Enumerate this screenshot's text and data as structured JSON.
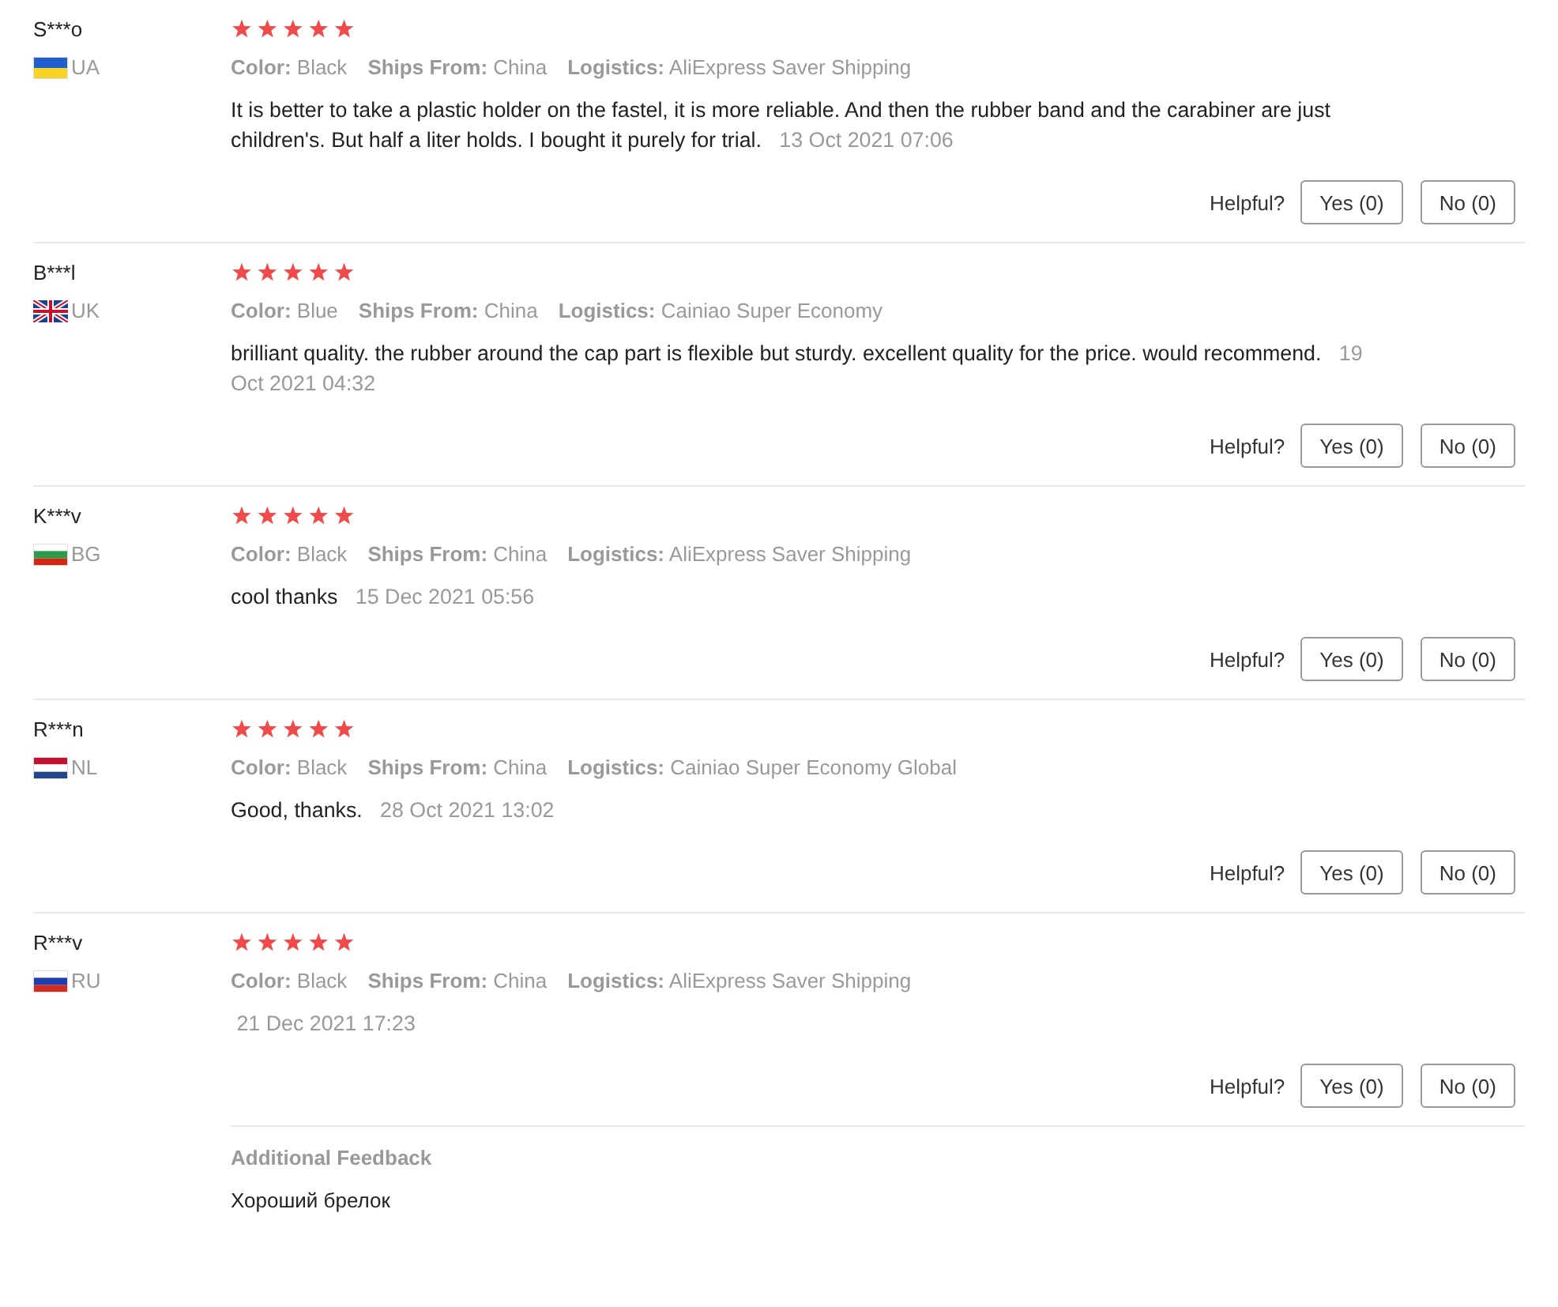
{
  "reviews": [
    {
      "user": "S***o",
      "country": "UA",
      "flag": {
        "kind": "ua"
      },
      "stars": 5,
      "attributes": [
        {
          "label": "Color:",
          "value": "Black"
        },
        {
          "label": "Ships From:",
          "value": "China"
        },
        {
          "label": "Logistics:",
          "value": "AliExpress Saver Shipping"
        }
      ],
      "text": "It is better to take a plastic holder on the fastel, it is more reliable. And then the rubber band and the carabiner are just children's. But half a liter holds. I bought it purely for trial.",
      "date": "13 Oct 2021 07:06",
      "helpful_label": "Helpful?",
      "yes": "Yes (0)",
      "no": "No (0)"
    },
    {
      "user": "B***l",
      "country": "UK",
      "flag": {
        "kind": "uk"
      },
      "stars": 5,
      "attributes": [
        {
          "label": "Color:",
          "value": "Blue"
        },
        {
          "label": "Ships From:",
          "value": "China"
        },
        {
          "label": "Logistics:",
          "value": "Cainiao Super Economy"
        }
      ],
      "text": "brilliant quality. the rubber around the cap part is flexible but sturdy. excellent quality for the price. would recommend.",
      "date": "19 Oct 2021 04:32",
      "helpful_label": "Helpful?",
      "yes": "Yes (0)",
      "no": "No (0)"
    },
    {
      "user": "K***v",
      "country": "BG",
      "flag": {
        "kind": "bg"
      },
      "stars": 5,
      "attributes": [
        {
          "label": "Color:",
          "value": "Black"
        },
        {
          "label": "Ships From:",
          "value": "China"
        },
        {
          "label": "Logistics:",
          "value": "AliExpress Saver Shipping"
        }
      ],
      "text": "cool thanks",
      "date": "15 Dec 2021 05:56",
      "helpful_label": "Helpful?",
      "yes": "Yes (0)",
      "no": "No (0)"
    },
    {
      "user": "R***n",
      "country": "NL",
      "flag": {
        "kind": "nl"
      },
      "stars": 5,
      "attributes": [
        {
          "label": "Color:",
          "value": "Black"
        },
        {
          "label": "Ships From:",
          "value": "China"
        },
        {
          "label": "Logistics:",
          "value": "Cainiao Super Economy Global"
        }
      ],
      "text": "Good, thanks.",
      "date": "28 Oct 2021 13:02",
      "helpful_label": "Helpful?",
      "yes": "Yes (0)",
      "no": "No (0)"
    },
    {
      "user": "R***v",
      "country": "RU",
      "flag": {
        "kind": "ru"
      },
      "stars": 5,
      "attributes": [
        {
          "label": "Color:",
          "value": "Black"
        },
        {
          "label": "Ships From:",
          "value": "China"
        },
        {
          "label": "Logistics:",
          "value": "AliExpress Saver Shipping"
        }
      ],
      "date": "21 Dec 2021 17:23",
      "helpful_label": "Helpful?",
      "yes": "Yes (0)",
      "no": "No (0)",
      "additional": {
        "title": "Additional Feedback",
        "text": "Хороший брелок"
      }
    }
  ]
}
